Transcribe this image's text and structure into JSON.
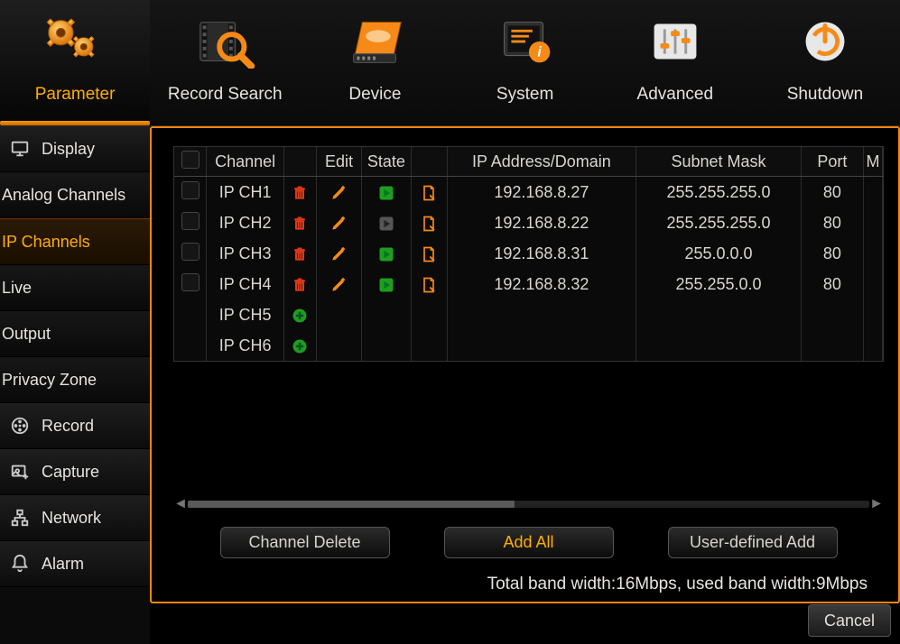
{
  "topnav": {
    "items": [
      {
        "label": "Parameter",
        "active": true
      },
      {
        "label": "Record Search"
      },
      {
        "label": "Device"
      },
      {
        "label": "System"
      },
      {
        "label": "Advanced"
      },
      {
        "label": "Shutdown"
      }
    ]
  },
  "sidebar": {
    "items": [
      {
        "label": "Display",
        "type": "section"
      },
      {
        "label": "Analog Channels",
        "type": "sub"
      },
      {
        "label": "IP Channels",
        "type": "sub",
        "active": true
      },
      {
        "label": "Live",
        "type": "sub"
      },
      {
        "label": "Output",
        "type": "sub"
      },
      {
        "label": "Privacy Zone",
        "type": "sub"
      },
      {
        "label": "Record",
        "type": "section"
      },
      {
        "label": "Capture",
        "type": "section"
      },
      {
        "label": "Network",
        "type": "section"
      },
      {
        "label": "Alarm",
        "type": "section"
      }
    ]
  },
  "table": {
    "headers": {
      "channel": "Channel",
      "edit": "Edit",
      "state": "State",
      "ip": "IP Address/Domain",
      "mask": "Subnet Mask",
      "port": "Port",
      "m": "M"
    },
    "rows": [
      {
        "channel": "IP CH1",
        "ip": "192.168.8.27",
        "mask": "255.255.255.0",
        "port": "80",
        "state": "online"
      },
      {
        "channel": "IP CH2",
        "ip": "192.168.8.22",
        "mask": "255.255.255.0",
        "port": "80",
        "state": "offline"
      },
      {
        "channel": "IP CH3",
        "ip": "192.168.8.31",
        "mask": "255.0.0.0",
        "port": "80",
        "state": "online"
      },
      {
        "channel": "IP CH4",
        "ip": "192.168.8.32",
        "mask": "255.255.0.0",
        "port": "80",
        "state": "online"
      },
      {
        "channel": "IP CH5",
        "empty": true
      },
      {
        "channel": "IP CH6",
        "empty": true
      }
    ]
  },
  "buttons": {
    "channel_delete": "Channel Delete",
    "add_all": "Add All",
    "user_add": "User-defined Add"
  },
  "bandwidth_text": "Total band width:16Mbps, used band width:9Mbps",
  "cancel_label": "Cancel"
}
